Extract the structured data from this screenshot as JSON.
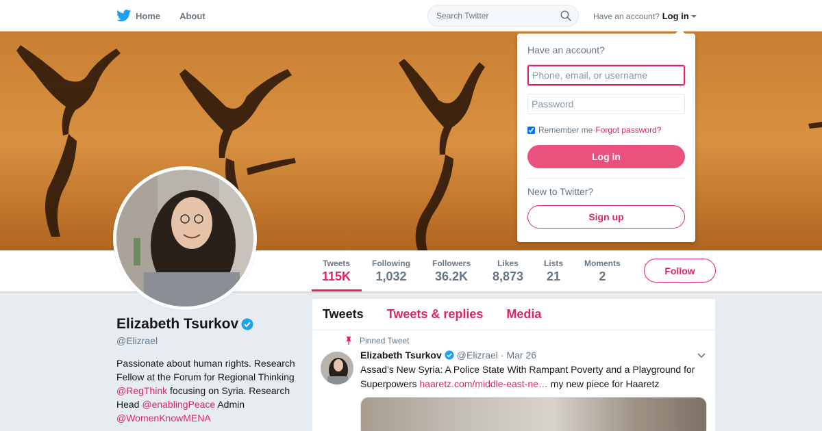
{
  "nav": {
    "home_label": "Home",
    "about_label": "About",
    "search_placeholder": "Search Twitter",
    "account_prompt": "Have an account?",
    "login_label": "Log in"
  },
  "profile": {
    "name": "Elizabeth Tsurkov",
    "handle": "@Elizrael",
    "bio": {
      "part1": "Passionate about human rights. Research Fellow at the Forum for Regional Thinking ",
      "mention1": "@RegThink",
      "part2": " focusing on Syria. Research Head ",
      "mention2": "@enablingPeace",
      "part3": " Admin ",
      "mention3": "@WomenKnowMENA"
    }
  },
  "stats": [
    {
      "label": "Tweets",
      "value": "115K"
    },
    {
      "label": "Following",
      "value": "1,032"
    },
    {
      "label": "Followers",
      "value": "36.2K"
    },
    {
      "label": "Likes",
      "value": "8,873"
    },
    {
      "label": "Lists",
      "value": "21"
    },
    {
      "label": "Moments",
      "value": "2"
    }
  ],
  "follow_label": "Follow",
  "timeline": {
    "tabs": [
      "Tweets",
      "Tweets & replies",
      "Media"
    ],
    "pinned_label": "Pinned Tweet",
    "tweet": {
      "author": "Elizabeth Tsurkov",
      "handle": "@Elizrael",
      "date": "· Mar 26",
      "text_before": "Assad’s New Syria: A Police State With Rampant Poverty and a Playground for Superpowers ",
      "link": "haaretz.com/middle-east-ne…",
      "text_after": " my new piece for Haaretz"
    }
  },
  "login_dropdown": {
    "title": "Have an account?",
    "username_placeholder": "Phone, email, or username",
    "password_placeholder": "Password",
    "remember_label": "Remember me",
    "separator": " · ",
    "forgot_label": "Forgot password?",
    "login_button": "Log in",
    "new_prompt": "New to Twitter?",
    "signup_button": "Sign up"
  },
  "colors": {
    "accent": "#e0245e",
    "twitter_blue": "#1da1f2"
  }
}
